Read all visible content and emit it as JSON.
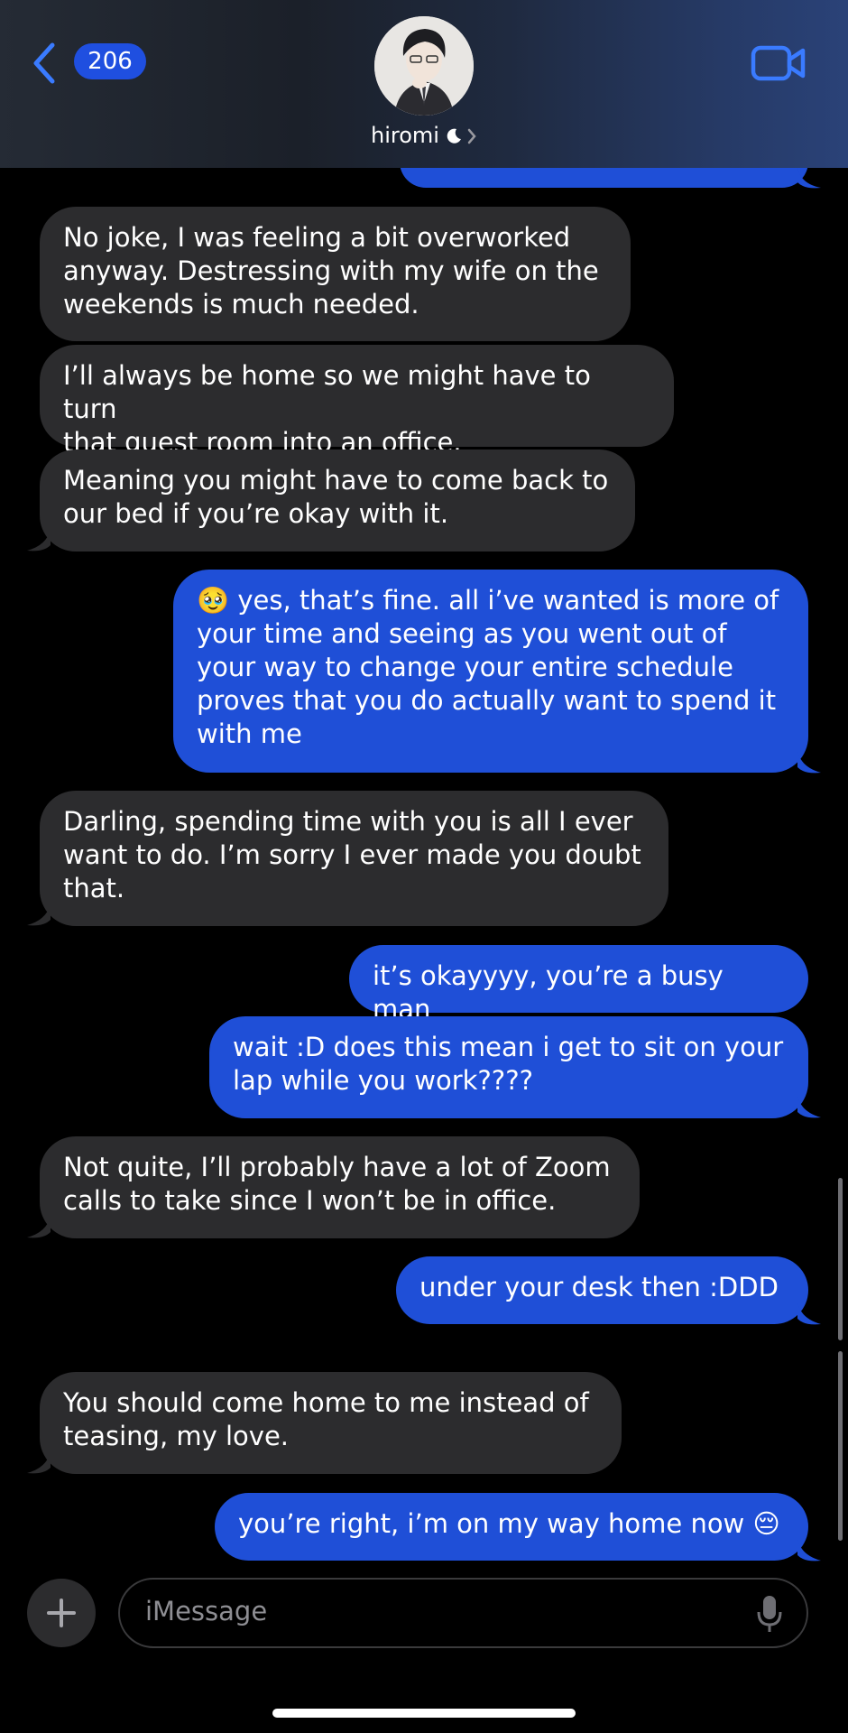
{
  "header": {
    "unread_count": "206",
    "contact_name": "hiromi"
  },
  "messages": [
    {
      "direction": "incoming",
      "text": "No joke, I was feeling a bit overworked\nanyway. Destressing with my wife on the\nweekends is much needed."
    },
    {
      "direction": "incoming",
      "text": "I’ll always be home so we might have to turn\nthat guest room into an office."
    },
    {
      "direction": "incoming",
      "text": "Meaning you might have to come back to\nour bed if you’re okay with it."
    },
    {
      "direction": "outgoing",
      "emoji": "🥹",
      "text": " yes, that’s fine. all i’ve wanted is more of\nyour time and seeing as you went out of\nyour way to change your entire schedule\nproves that you do actually want to spend it\nwith me"
    },
    {
      "direction": "incoming",
      "text": "Darling, spending time with you is all I ever\nwant to do. I’m sorry I ever made you doubt\nthat."
    },
    {
      "direction": "outgoing",
      "text": "it’s okayyyy, you’re a busy man"
    },
    {
      "direction": "outgoing",
      "text": "wait :D does this mean i get to sit on your\nlap while you work????"
    },
    {
      "direction": "incoming",
      "text": "Not quite, I’ll probably have a lot of Zoom\ncalls to take since I won’t be in office."
    },
    {
      "direction": "outgoing",
      "text": "under your desk then :DDD"
    },
    {
      "direction": "incoming",
      "text": "You should come home to me instead of\nteasing, my love."
    },
    {
      "direction": "outgoing",
      "text": "you’re right, i’m on my way home now ",
      "emoji": "😔"
    }
  ],
  "composer": {
    "placeholder": "iMessage"
  },
  "colors": {
    "incoming_bubble": "#2c2c2e",
    "outgoing_bubble": "#1f4fd7",
    "accent": "#3a7bff",
    "background": "#000000"
  },
  "icons": [
    "back-chevron-icon",
    "moon-icon",
    "chevron-right-icon",
    "video-camera-icon",
    "plus-icon",
    "microphone-icon"
  ]
}
